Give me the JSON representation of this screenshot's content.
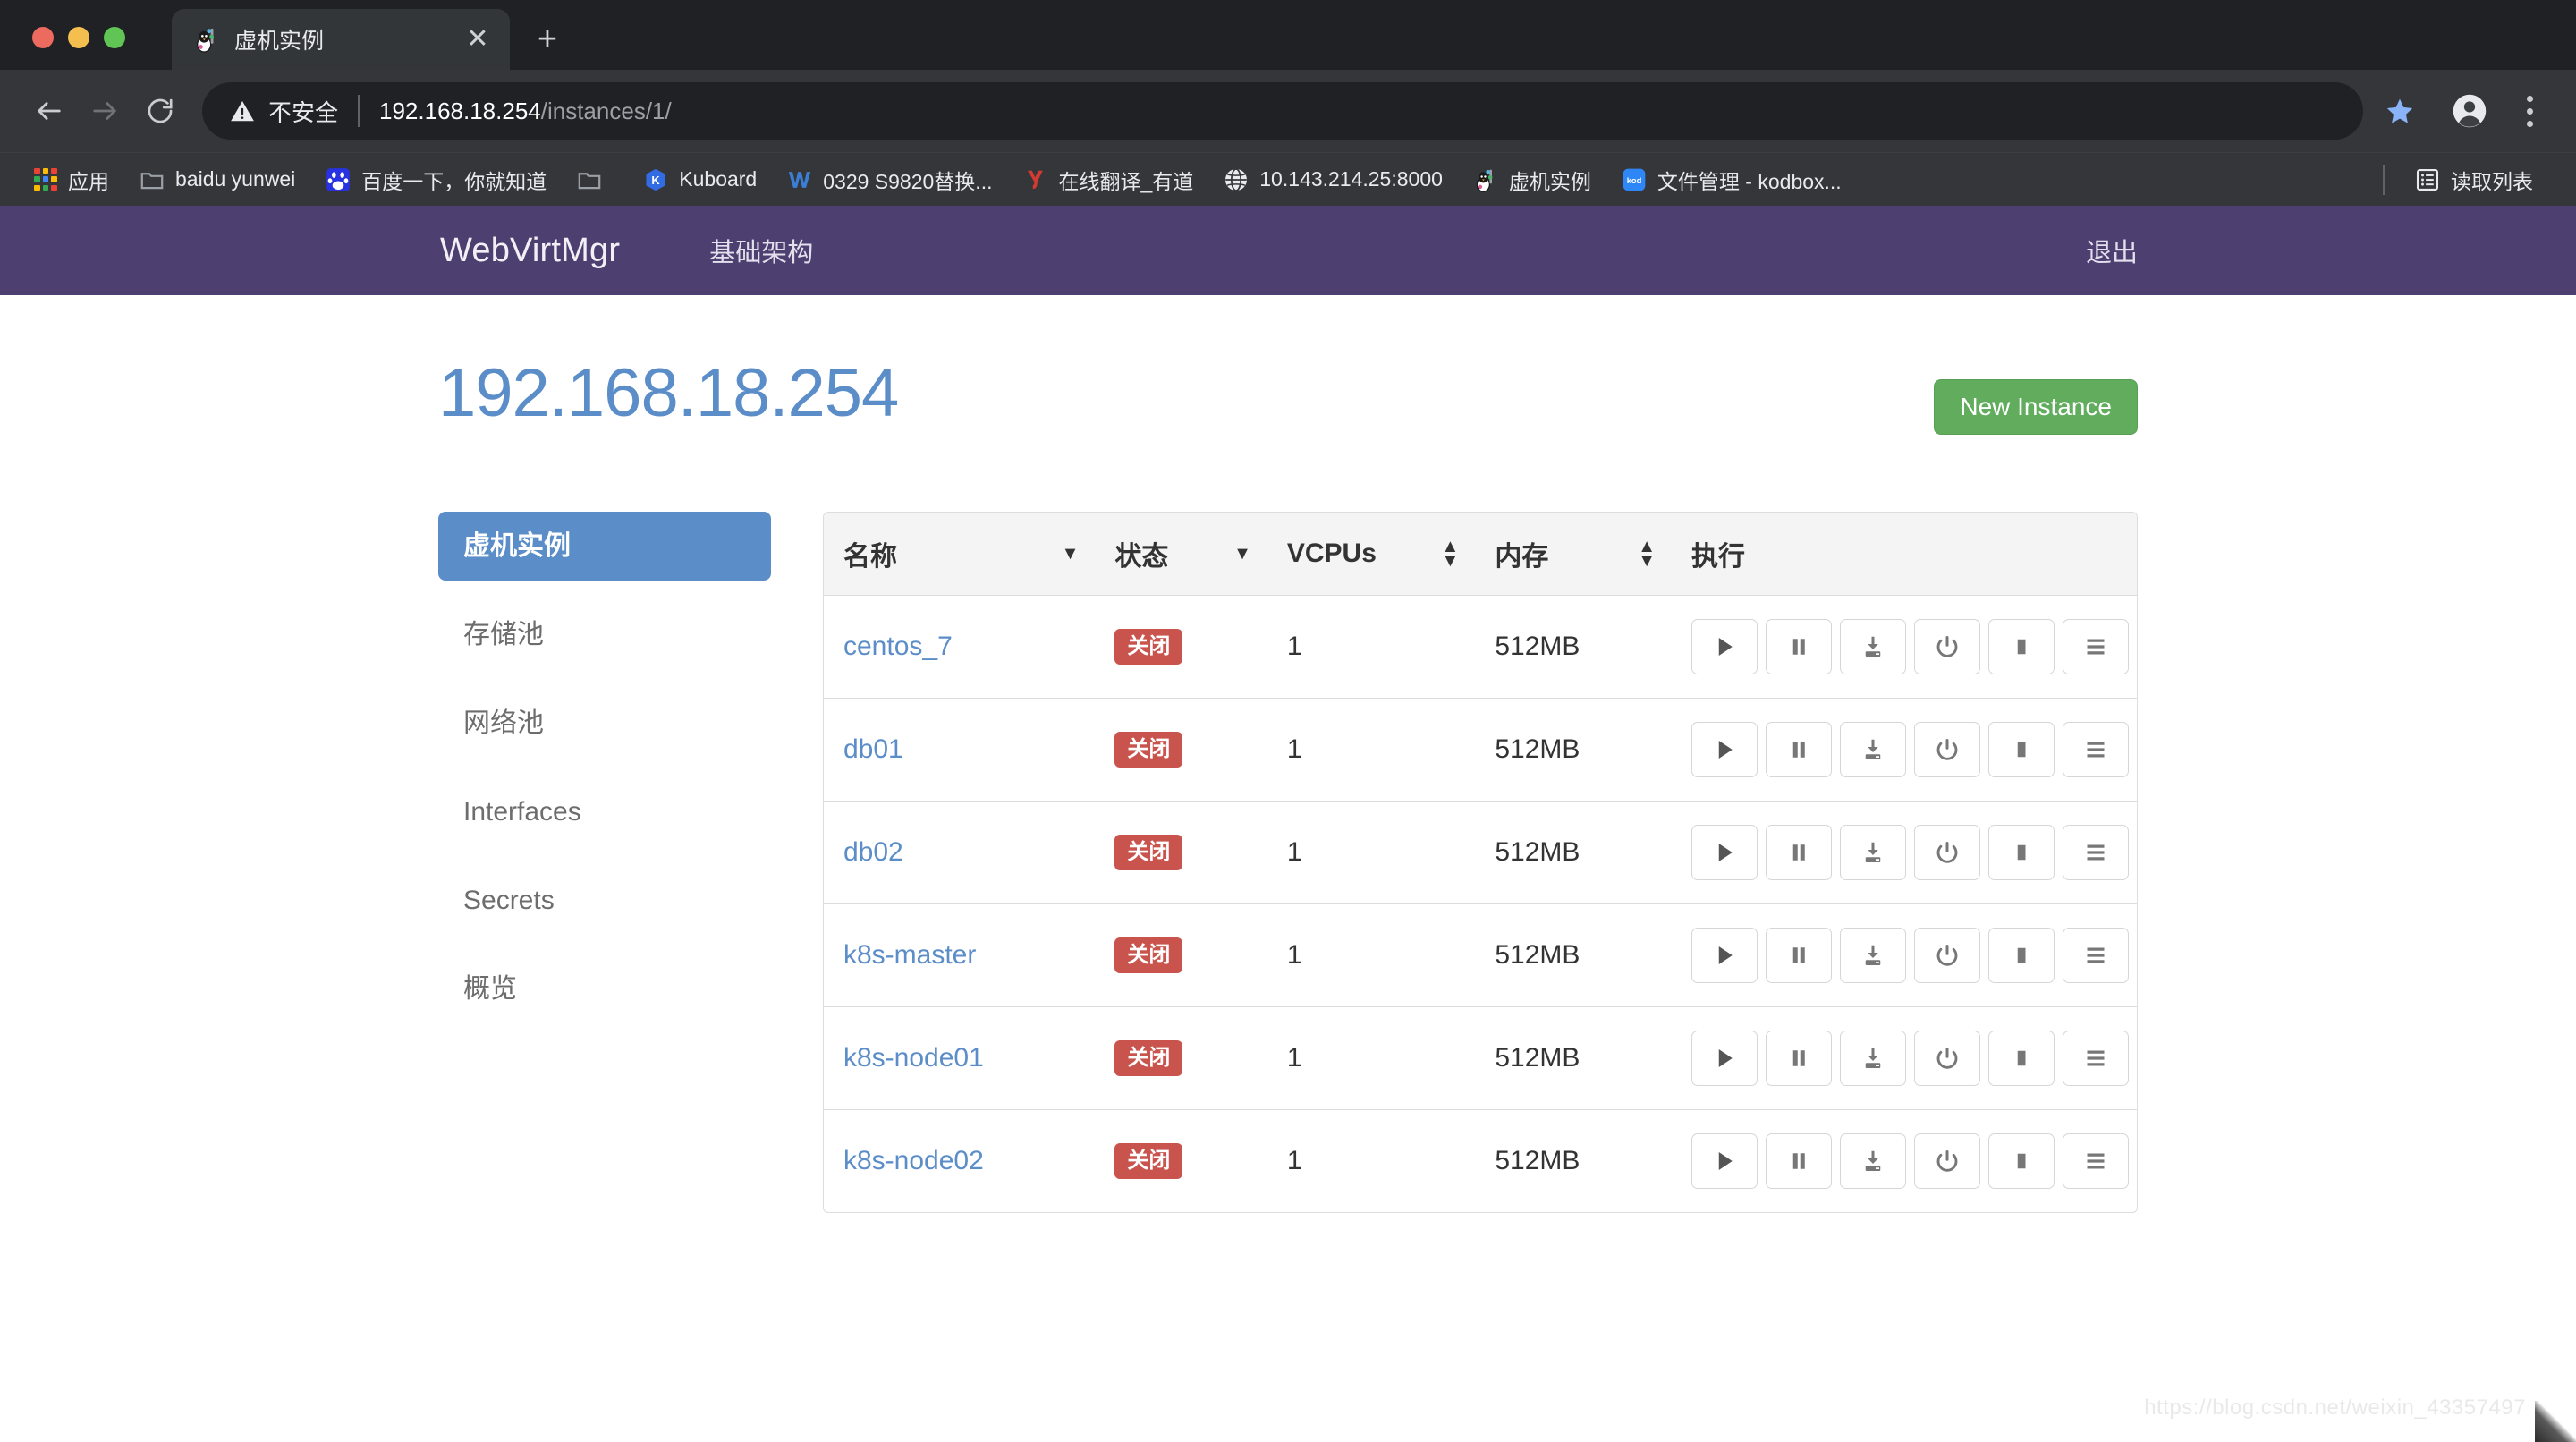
{
  "browser": {
    "tab": {
      "title": "虚机实例",
      "favicon": "penguin-favicon",
      "close_label": "✕"
    },
    "new_tab_label": "+",
    "toolbar": {
      "back_icon": "back-arrow-icon",
      "forward_icon": "forward-arrow-icon",
      "reload_icon": "reload-icon",
      "security_label": "不安全",
      "security_icon": "warning-triangle-icon",
      "url_host": "192.168.18.254",
      "url_path": "/instances/1/",
      "url_full": "192.168.18.254/instances/1/",
      "star_icon": "bookmark-star-icon",
      "profile_icon": "profile-avatar-icon",
      "menu_icon": "three-dot-menu-icon"
    },
    "bookmarks": [
      {
        "label": "应用",
        "icon": "apps-grid-icon"
      },
      {
        "label": "baidu yunwei",
        "icon": "folder-icon"
      },
      {
        "label": "百度一下，你就知道",
        "icon": "baidu-icon"
      },
      {
        "label": "",
        "icon": "folder-icon"
      },
      {
        "label": "Kuboard",
        "icon": "kuboard-icon"
      },
      {
        "label": "0329 S9820替换...",
        "icon": "wps-writer-icon"
      },
      {
        "label": "在线翻译_有道",
        "icon": "youdao-icon"
      },
      {
        "label": "10.143.214.25:8000",
        "icon": "globe-icon"
      },
      {
        "label": "虚机实例",
        "icon": "penguin-favicon"
      },
      {
        "label": "文件管理 - kodbox...",
        "icon": "kodbox-icon"
      }
    ],
    "reading_list": {
      "label": "读取列表",
      "icon": "reading-list-icon"
    }
  },
  "navbar": {
    "brand": "WebVirtMgr",
    "links": [
      {
        "label": "基础架构"
      }
    ],
    "logout": "退出",
    "bg_color": "#4e3f71"
  },
  "header": {
    "title": "192.168.18.254",
    "title_color": "#5b8dc8",
    "new_instance_button": "New Instance",
    "new_instance_color": "#61ad5d"
  },
  "sidebar": {
    "items": [
      {
        "label": "虚机实例",
        "active": true
      },
      {
        "label": "存储池",
        "active": false
      },
      {
        "label": "网络池",
        "active": false
      },
      {
        "label": "Interfaces",
        "active": false
      },
      {
        "label": "Secrets",
        "active": false
      },
      {
        "label": "概览",
        "active": false
      }
    ]
  },
  "table": {
    "columns": [
      {
        "label": "名称",
        "sort": "desc",
        "key": "name"
      },
      {
        "label": "状态",
        "sort": "desc",
        "key": "status"
      },
      {
        "label": "VCPUs",
        "sort": "both",
        "key": "vcpus"
      },
      {
        "label": "内存",
        "sort": "both",
        "key": "memory"
      },
      {
        "label": "执行",
        "sort": "none",
        "key": "actions"
      }
    ],
    "rows": [
      {
        "name": "centos_7",
        "status": "关闭",
        "vcpus": "1",
        "memory": "512MB"
      },
      {
        "name": "db01",
        "status": "关闭",
        "vcpus": "1",
        "memory": "512MB"
      },
      {
        "name": "db02",
        "status": "关闭",
        "vcpus": "1",
        "memory": "512MB"
      },
      {
        "name": "k8s-master",
        "status": "关闭",
        "vcpus": "1",
        "memory": "512MB"
      },
      {
        "name": "k8s-node01",
        "status": "关闭",
        "vcpus": "1",
        "memory": "512MB"
      },
      {
        "name": "k8s-node02",
        "status": "关闭",
        "vcpus": "1",
        "memory": "512MB"
      }
    ],
    "status_badge_color": "#c9544d",
    "link_color": "#5b8dc8",
    "actions": [
      {
        "icon": "play-icon",
        "title": "start"
      },
      {
        "icon": "pause-icon",
        "title": "suspend"
      },
      {
        "icon": "download-icon",
        "title": "save"
      },
      {
        "icon": "power-icon",
        "title": "power"
      },
      {
        "icon": "stop-icon",
        "title": "force off"
      },
      {
        "icon": "menu-icon",
        "title": "more"
      }
    ]
  },
  "watermark": "https://blog.csdn.net/weixin_43357497"
}
